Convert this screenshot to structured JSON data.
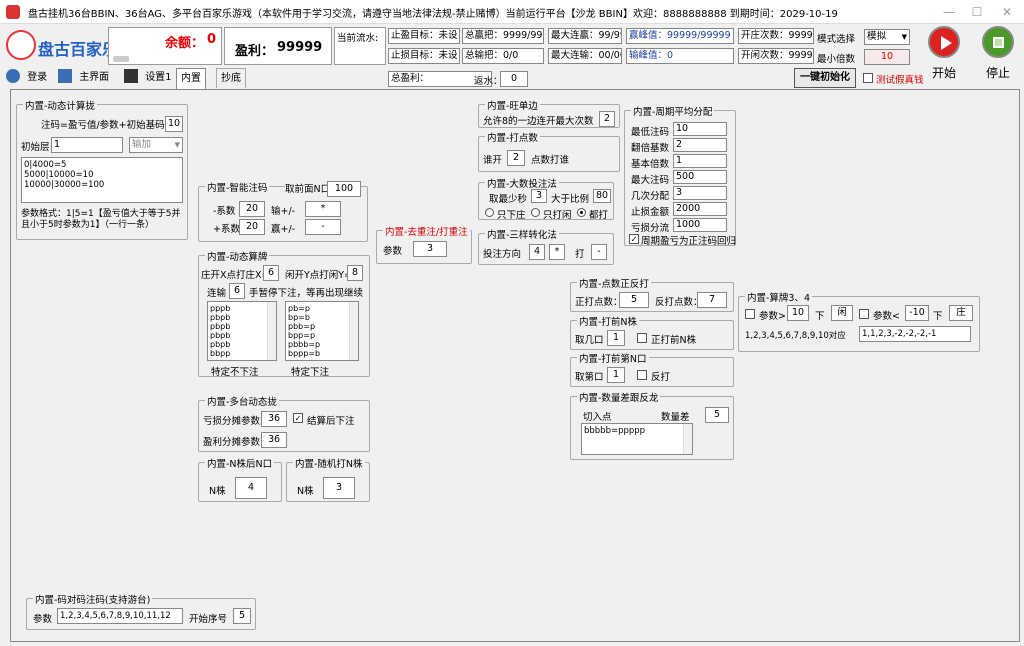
{
  "window": {
    "title": "盘古挂机36台BBIN、36台AG、多平台百家乐游戏（本软件用于学习交流，请遵守当地法律法规-禁止赌博）当前运行平台【沙龙 BBIN】欢迎：8888888888 到期时间：2029-10-19",
    "minimize": "—",
    "maximize": "☐",
    "close": "✕"
  },
  "header": {
    "logo_text": "盘古百家乐",
    "balance_label": "余额：",
    "balance_value": "0",
    "profit_label": "盈利：",
    "profit_value": "99999",
    "current_flow_label": "当前流水:",
    "stop_win_label": "止盈目标：",
    "stop_win_value": "未设",
    "stop_loss_label": "止损目标：",
    "stop_loss_value": "未设",
    "total_win_hands": "总赢把：9999/9999",
    "total_loss_hands": "总输把：0/0",
    "max_win_streak": "最大连赢：99/99",
    "max_loss_streak": "最大连输：00/00",
    "win_peak": "赢峰值：99999/99999",
    "loss_peak": "输峰值：0",
    "open_count": "开庄次数：999999",
    "open_xian_count": "开闲次数：999999",
    "mode_label": "模式选择",
    "mode_value": "模拟",
    "min_multiplier_label": "最小倍数",
    "min_multiplier_value": "10",
    "start_label": "开始",
    "stop_label": "停止",
    "total_profit_label": "总盈利：",
    "rebate_label": "返水：",
    "rebate_value": "0",
    "init_button": "一键初始化",
    "test_real_label": "测试假真钱"
  },
  "tabs": [
    {
      "label": "登录"
    },
    {
      "label": "主界面"
    },
    {
      "label": "设置1"
    },
    {
      "label": "内置"
    },
    {
      "label": "抄底"
    }
  ],
  "dynamic_calc": {
    "title": "内置-动态计算拢",
    "formula": "注码=盈亏值/参数+初始基码",
    "formula_value": "10",
    "init_layer_label": "初始层",
    "init_layer_value": "1",
    "select_value": "输加",
    "textarea": "0|4000=5\n5000|10000=10\n10000|30000=100",
    "hint": "参数格式：1|5=1【盈亏值大于等于5并且小于5时参数为1】（一行一条）"
  },
  "smart_bet": {
    "title": "内置-智能注码",
    "front_n_label": "取前面N口",
    "front_n_value": "100",
    "coef1_label": "-系数",
    "coef1_value": "20",
    "coef1_op_label": "输+/-",
    "coef1_op": "*",
    "coef2_label": "+系数",
    "coef2_value": "20",
    "coef2_op_label": "赢+/-",
    "coef2_op": "-"
  },
  "dynamic_calc_bet": {
    "title": "内置-动态算牌",
    "zhuang_label": "庄开X点打庄X=",
    "zhuang_value": "6",
    "xian_label": "闲开Y点打闲Y=",
    "xian_value": "8",
    "streak_label": "连输",
    "streak_value": "6",
    "streak_hint": "手暂停下注，等再出现继续",
    "list1": "pppb\npbpb\npbpb\npbpb\npbpb\nbbpp",
    "list1_label": "特定不下注",
    "list2": "pb=p\nbp=b\npbb=p\nbpp=p\npbbb=p\nbppp=b",
    "list2_label": "特定下注"
  },
  "multi_table": {
    "title": "内置-多台动态拢",
    "loss_label": "亏损分摊参数",
    "loss_value": "36",
    "settle_label": "结算后下注",
    "profit_label": "盈利分摊参数",
    "profit_value": "36"
  },
  "n_after": {
    "title": "内置-N株后N口",
    "label": "N株",
    "value": "4"
  },
  "random_n": {
    "title": "内置-随机打N株",
    "label": "N株",
    "value": "3"
  },
  "go_heavy": {
    "title": "内置-去重注/打重注",
    "label": "参数",
    "value": "3"
  },
  "one_side": {
    "title": "内置-旺单边",
    "label": "允许8的一边连开最大次数",
    "value": "2"
  },
  "hit_points": {
    "title": "内置-打点数",
    "prefix": "谁开",
    "value": "2",
    "suffix": "点数打谁"
  },
  "big_count": {
    "title": "内置-大数投注法",
    "min_label": "取最少秒",
    "min_value": "3",
    "ratio_label": "大于比例",
    "ratio_value": "80",
    "opt1": "只下庄",
    "opt2": "只打闲",
    "opt3": "都打"
  },
  "three_convert": {
    "title": "内置-三样转化法",
    "dir_label": "投注方向",
    "dir_value": "4",
    "op": "*",
    "hit_label": "打",
    "hit_value": "-"
  },
  "period_avg": {
    "title": "内置-周期平均分配",
    "rows": [
      {
        "label": "最低注码",
        "value": "10"
      },
      {
        "label": "翻倍基数",
        "value": "2"
      },
      {
        "label": "基本倍数",
        "value": "1"
      },
      {
        "label": "最大注码",
        "value": "500"
      },
      {
        "label": "几次分配",
        "value": "3"
      },
      {
        "label": "止损金额",
        "value": "2000"
      },
      {
        "label": "亏损分流",
        "value": "1000"
      }
    ],
    "cycle_label": "周期盈亏为正注码回归"
  },
  "point_reverse": {
    "title": "内置-点数正反打",
    "pos_label": "正打点数：",
    "pos_value": "5",
    "neg_label": "反打点数：",
    "neg_value": "7"
  },
  "front_n": {
    "title": "内置-打前N株",
    "label": "取几口",
    "value": "1",
    "check_label": "正打前N株"
  },
  "front_n_mouth": {
    "title": "内置-打前第N口",
    "label": "取第口",
    "value": "1",
    "check_label": "反打"
  },
  "count_diff": {
    "title": "内置-数量差跟反龙",
    "cut_label": "切入点",
    "diff_label": "数量差",
    "diff_value": "5",
    "textarea": "bbbbb=ppppp"
  },
  "calc34": {
    "title": "内置-算牌3、4",
    "param1_label": "参数>",
    "param1_value": "10",
    "down1_label": "下",
    "down1_value": "闲",
    "param2_label": "参数<",
    "param2_value": "-10",
    "down2_label": "下",
    "down2_value": "庄",
    "seq_left": "1,2,3,4,5,6,7,8,9,10对应",
    "seq_right": "1,1,2,3,-2,-2,-2,-1"
  },
  "code_pair": {
    "title": "内置-码对码注码(支持游台)",
    "param_label": "参数",
    "param_value": "1,2,3,4,5,6,7,8,9,10,11,12",
    "start_label": "开始序号",
    "start_value": "5"
  }
}
